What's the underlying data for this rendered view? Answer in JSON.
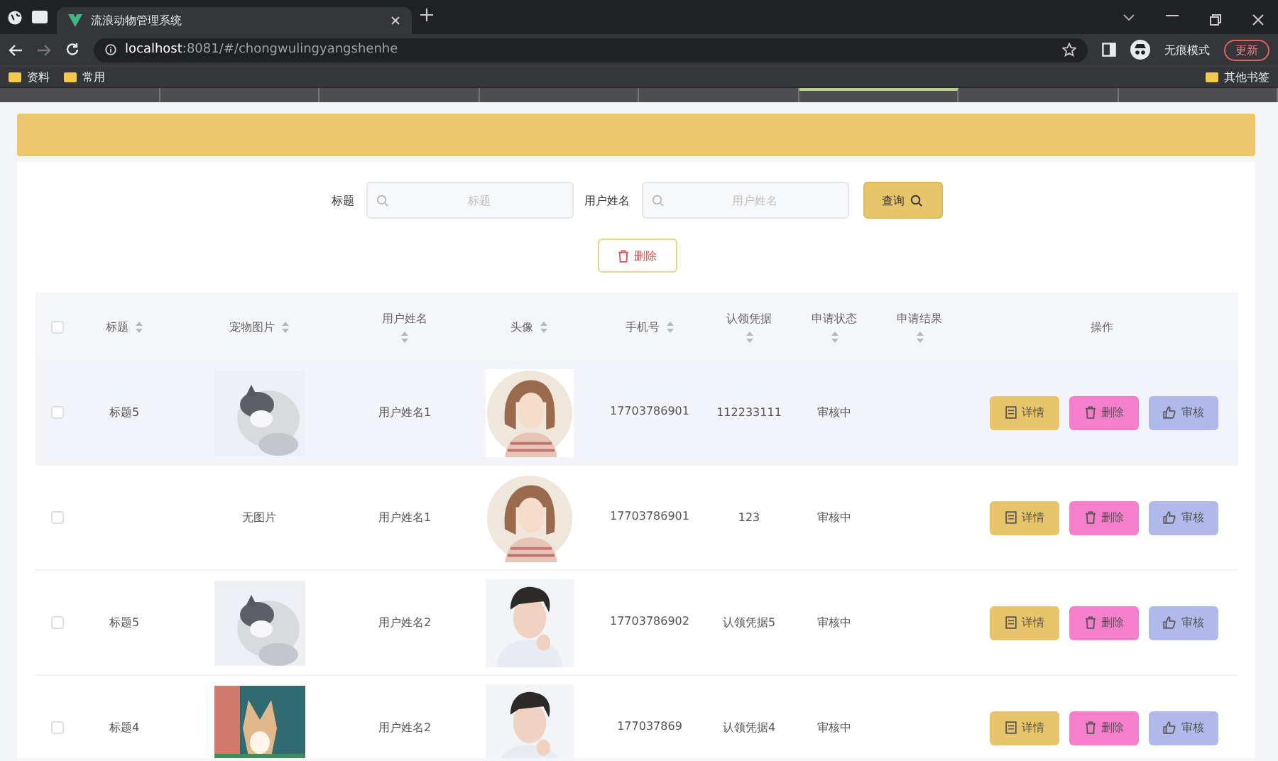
{
  "browser": {
    "tab_title": "流浪动物管理系统",
    "url_host": "localhost",
    "url_rest": ":8081/#/chongwulingyangshenhe",
    "profile": "无痕模式",
    "update": "更新",
    "bookmarks": [
      "资料",
      "常用"
    ],
    "other_bookmarks": "其他书签",
    "strip_tabs": [
      {
        "selected": false
      },
      {
        "selected": false
      },
      {
        "selected": false
      },
      {
        "selected": false
      },
      {
        "selected": false
      },
      {
        "selected": true
      },
      {
        "selected": false
      },
      {
        "selected": false
      }
    ]
  },
  "search": {
    "fields": [
      {
        "label": "标题",
        "placeholder": "标题"
      },
      {
        "label": "用户姓名",
        "placeholder": "用户姓名"
      }
    ],
    "button": "查询"
  },
  "delete_button": "删除",
  "table": {
    "select_all": {
      "checked": false
    },
    "columns": [
      {
        "label": "标题",
        "sortable": true
      },
      {
        "label": "宠物图片",
        "sortable": true
      },
      {
        "label": "用户姓名",
        "sortable": true
      },
      {
        "label": "头像",
        "sortable": true
      },
      {
        "label": "手机号",
        "sortable": true
      },
      {
        "label": "认领凭据",
        "sortable": true
      },
      {
        "label": "申请状态",
        "sortable": true
      },
      {
        "label": "申请结果",
        "sortable": true
      },
      {
        "label": "操作",
        "sortable": false
      }
    ],
    "rows": [
      {
        "checked": false,
        "highlighted": true,
        "title": "标题5",
        "pet_picture": {
          "kind": "picture"
        },
        "user_name": "用户姓名1",
        "avatar": {
          "kind": "picture"
        },
        "phone": "17703786901",
        "proof": "112233111",
        "status": "审核中",
        "actions": [
          "详情",
          "删除",
          "审核"
        ]
      },
      {
        "checked": false,
        "highlighted": false,
        "pet_picture": {
          "kind": "text",
          "text": "无图片"
        },
        "user_name": "用户姓名1",
        "avatar": {
          "kind": "picture"
        },
        "phone": "17703786901",
        "proof": "123",
        "status": "审核中",
        "actions": [
          "详情",
          "删除",
          "审核"
        ]
      },
      {
        "checked": false,
        "highlighted": false,
        "title": "标题5",
        "pet_picture": {
          "kind": "picture"
        },
        "user_name": "用户姓名2",
        "avatar": {
          "kind": "picture"
        },
        "phone": "17703786902",
        "proof": "认领凭据5",
        "status": "审核中",
        "actions": [
          "详情",
          "删除",
          "审核"
        ]
      },
      {
        "checked": false,
        "highlighted": false,
        "title": "标题4",
        "pet_picture": {
          "kind": "picture"
        },
        "user_name": "用户姓名2",
        "avatar": {
          "kind": "picture"
        },
        "phone": "177037869",
        "proof": "认领凭据4",
        "status": "审核中",
        "actions": [
          "详情",
          "删除",
          "审核"
        ]
      }
    ]
  }
}
